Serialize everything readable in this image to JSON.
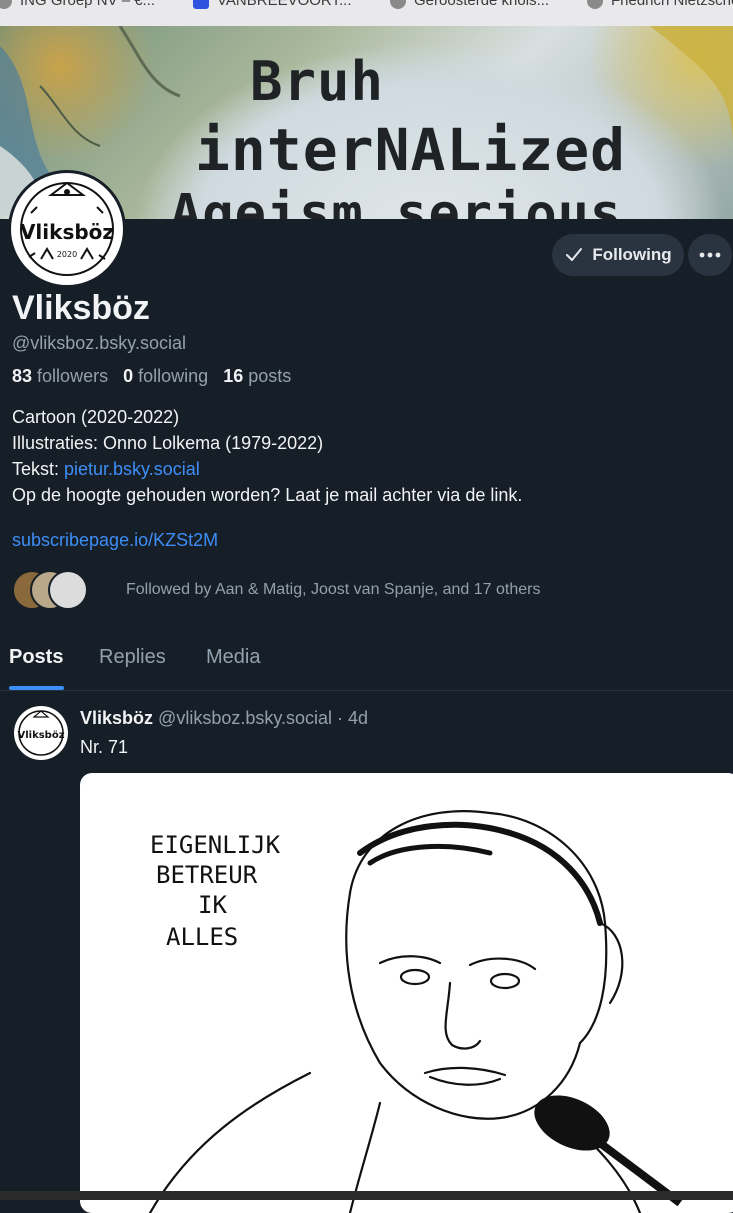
{
  "bookmarks": [
    {
      "label": "ING Groep NV – €...",
      "icon": "ing-favicon"
    },
    {
      "label": "VANBREEVOORT...",
      "icon": "arrow-favicon"
    },
    {
      "label": "Geroosterde knols...",
      "icon": "globe-favicon"
    },
    {
      "label": "Friedrich Nietzsche",
      "icon": "globe-favicon"
    }
  ],
  "banner": {
    "line1": "Bruh",
    "line2": "interNALized",
    "line3": "Ageism serious"
  },
  "profile": {
    "avatar_text": "Vliksböz",
    "avatar_years": "2020",
    "name": "Vliksböz",
    "handle": "@vliksboz.bsky.social",
    "followers_count": "83",
    "followers_label": "followers",
    "following_count": "0",
    "following_label": "following",
    "posts_count": "16",
    "posts_label": "posts",
    "bio": {
      "line1": "Cartoon (2020-2022)",
      "line2": "Illustraties: Onno Lolkema (1979-2022)",
      "line3_prefix": "Tekst: ",
      "line3_link": "pietur.bsky.social",
      "line4": "Op de hoogte gehouden worden? Laat je mail achter via de link."
    },
    "link": "subscribepage.io/KZSt2M",
    "followed_by": {
      "prefix": "Followed by ",
      "name1": "Aan",
      "amp": " & ",
      "name2": "Matig",
      "rest": ", Joost van Spanje, and 17 others"
    }
  },
  "actions": {
    "following_label": "Following",
    "more_icon": "ellipsis-icon",
    "check_icon": "check-icon"
  },
  "tabs": [
    "Posts",
    "Replies",
    "Media"
  ],
  "post": {
    "author": "Vliksböz",
    "handle": "@vliksboz.bsky.social",
    "separator": " · ",
    "time": "4d",
    "text": "Nr. 71",
    "image_caption_lines": [
      "EIGENLIJK",
      "BETREUR",
      "IK",
      "ALLES"
    ]
  }
}
